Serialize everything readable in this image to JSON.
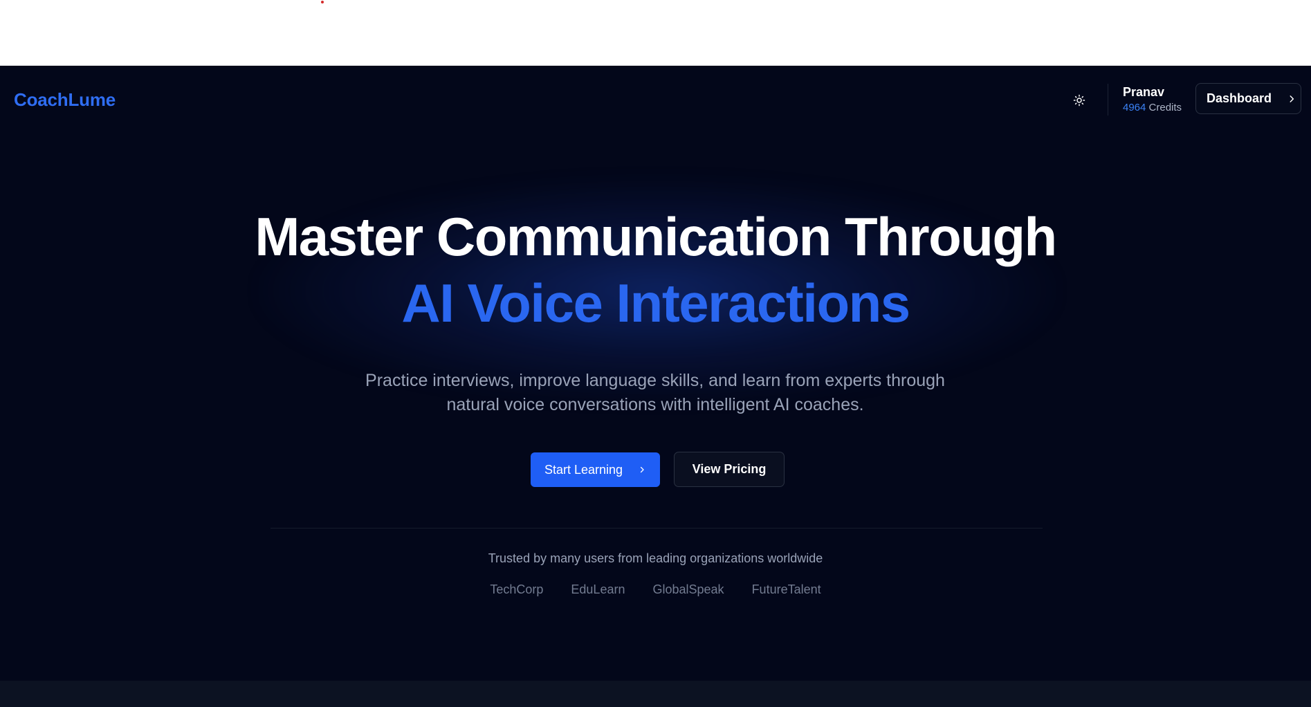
{
  "header": {
    "logo": "CoachLume",
    "user": {
      "name": "Pranav",
      "credits_value": "4964",
      "credits_label": "Credits"
    },
    "dashboard_label": "Dashboard",
    "icons": {
      "theme": "sun-icon",
      "dashboard_arrow": "chevron-right-icon"
    }
  },
  "hero": {
    "title_line1": "Master Communication Through",
    "title_line2": "AI Voice Interactions",
    "subtitle_line1": "Practice interviews, improve language skills, and learn from experts through",
    "subtitle_line2": "natural voice conversations with intelligent AI coaches."
  },
  "buttons": {
    "start_label": "Start Learning",
    "pricing_label": "View Pricing"
  },
  "trust": {
    "text": "Trusted by many users from leading organizations worldwide",
    "orgs": [
      "TechCorp",
      "EduLearn",
      "GlobalSpeak",
      "FutureTalent"
    ]
  },
  "colors": {
    "background": "#03071a",
    "accent": "#2a67f0",
    "button_primary": "#1f5ef5",
    "text_muted": "#9aa3b8"
  }
}
